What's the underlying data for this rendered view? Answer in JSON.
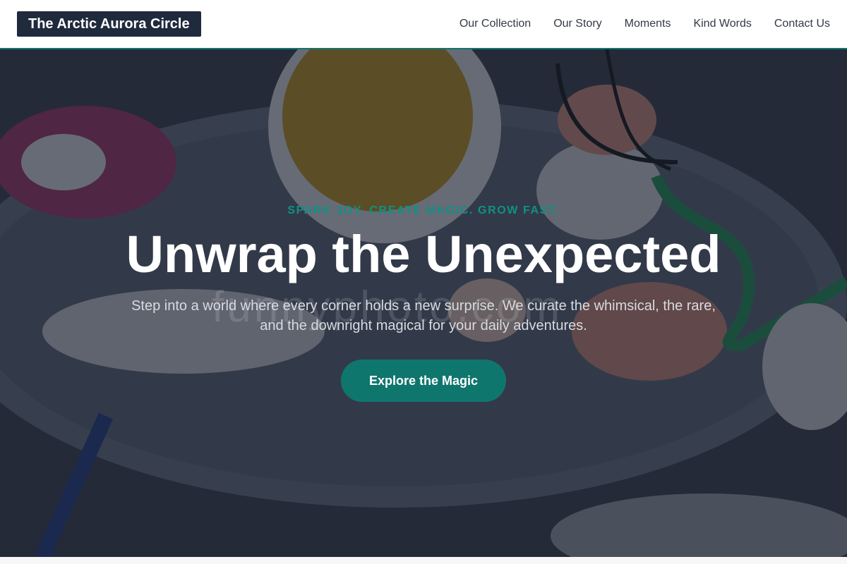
{
  "brand": {
    "name": "The Arctic Aurora Circle"
  },
  "nav": {
    "items": [
      {
        "label": "Our Collection"
      },
      {
        "label": "Our Story"
      },
      {
        "label": "Moments"
      },
      {
        "label": "Kind Words"
      },
      {
        "label": "Contact Us"
      }
    ]
  },
  "hero": {
    "kicker": "SPARK JOY. CREATE MAGIC. GROW FAST.",
    "headline": "Unwrap the Unexpected",
    "subtitle": "Step into a world where every corner holds a new surprise. We curate the whimsical, the rare, and the downright magical for your daily adventures.",
    "cta_label": "Explore the Magic",
    "watermark": "funnyphoto.com"
  },
  "colors": {
    "accent": "#0f766e",
    "brand_bg": "#1f2a3c",
    "overlay": "#191e2d"
  }
}
